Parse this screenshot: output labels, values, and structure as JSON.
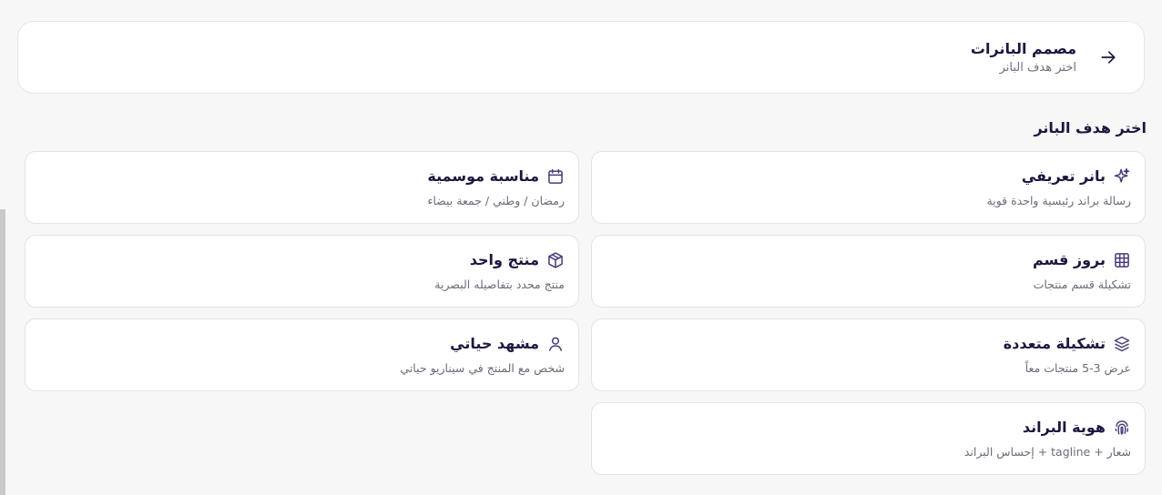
{
  "header": {
    "title": "مصمم البانرات",
    "subtitle": "اختر هدف البانر"
  },
  "section": {
    "title": "اختر هدف البانر"
  },
  "accent_color": "#4a3a78",
  "cards": [
    {
      "title": "بانر تعريفي",
      "desc": "رسالة براند رئيسية واحدة قوية",
      "icon": "sparkles-icon"
    },
    {
      "title": "مناسبة موسمية",
      "desc": "رمضان / وطني / جمعة بيضاء",
      "icon": "calendar-icon"
    },
    {
      "title": "بروز قسم",
      "desc": "تشكيلة قسم منتجات",
      "icon": "grid-icon"
    },
    {
      "title": "منتج واحد",
      "desc": "منتج محدد بتفاصيله البصرية",
      "icon": "package-icon"
    },
    {
      "title": "تشكيلة متعددة",
      "desc": "عرض 3-5 منتجات معاً",
      "icon": "layers-icon"
    },
    {
      "title": "مشهد حياتي",
      "desc": "شخص مع المنتج في سيناريو حياتي",
      "icon": "user-icon"
    },
    {
      "title": "هوية البراند",
      "desc": "شعار + tagline + إحساس البراند",
      "icon": "fingerprint-icon"
    }
  ]
}
